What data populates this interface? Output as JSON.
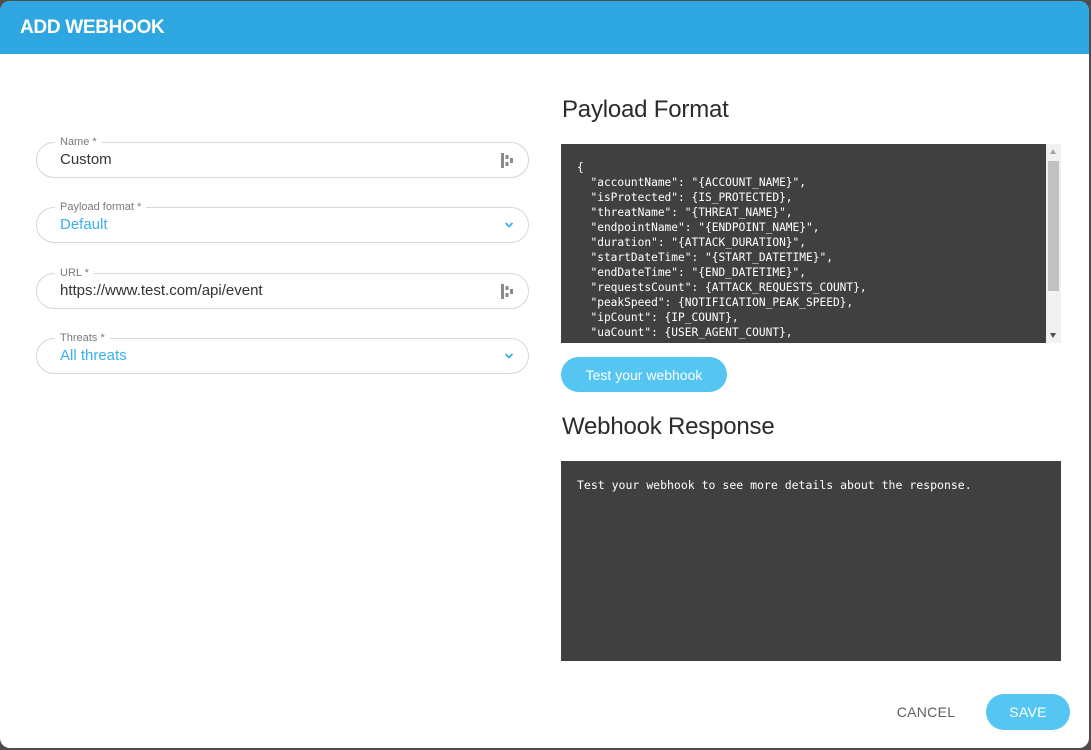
{
  "modal": {
    "title": "ADD WEBHOOK"
  },
  "form": {
    "name": {
      "label": "Name *",
      "value": "Custom"
    },
    "payload_format": {
      "label": "Payload format *",
      "value": "Default"
    },
    "url": {
      "label": "URL *",
      "value": "https://www.test.com/api/event"
    },
    "threats": {
      "label": "Threats *",
      "value": "All threats"
    }
  },
  "payload": {
    "title": "Payload Format",
    "code": "{\n  \"accountName\": \"{ACCOUNT_NAME}\",\n  \"isProtected\": {IS_PROTECTED},\n  \"threatName\": \"{THREAT_NAME}\",\n  \"endpointName\": \"{ENDPOINT_NAME}\",\n  \"duration\": \"{ATTACK_DURATION}\",\n  \"startDateTime\": \"{START_DATETIME}\",\n  \"endDateTime\": \"{END_DATETIME}\",\n  \"requestsCount\": {ATTACK_REQUESTS_COUNT},\n  \"peakSpeed\": {NOTIFICATION_PEAK_SPEED},\n  \"ipCount\": {IP_COUNT},\n  \"uaCount\": {USER_AGENT_COUNT},"
  },
  "test_button": {
    "label": "Test your webhook"
  },
  "response": {
    "title": "Webhook Response",
    "text": "Test your webhook to see more details about the response."
  },
  "footer": {
    "cancel_label": "CANCEL",
    "save_label": "SAVE"
  },
  "colors": {
    "accent": "#2ea6e2",
    "button": "#55c5f2",
    "code_bg": "#404040"
  },
  "icons": {
    "field_action": "password-manager-icon",
    "dropdown": "chevron-down-icon"
  }
}
